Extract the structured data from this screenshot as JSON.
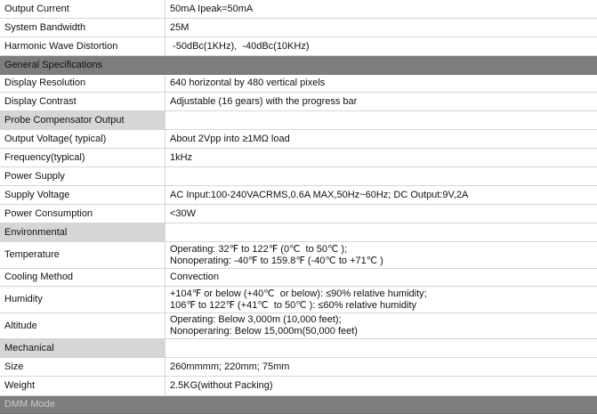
{
  "table": {
    "rows": [
      {
        "kind": "spec",
        "label": "Output Current",
        "value": [
          "50mA Ipeak=50mA"
        ]
      },
      {
        "kind": "spec",
        "label": "System Bandwidth",
        "value": [
          "25M"
        ]
      },
      {
        "kind": "spec",
        "label": "Harmonic Wave Distortion",
        "value": [
          " -50dBc(1KHz),  -40dBc(10KHz)"
        ]
      },
      {
        "kind": "section-dark",
        "label": "General Specifications"
      },
      {
        "kind": "spec",
        "label": "Display Resolution",
        "value": [
          "640 horizontal by 480 vertical pixels"
        ]
      },
      {
        "kind": "spec",
        "label": "Display Contrast",
        "value": [
          "Adjustable (16 gears) with the progress bar"
        ]
      },
      {
        "kind": "section-light",
        "label": "Probe Compensator Output",
        "value": []
      },
      {
        "kind": "spec",
        "label": "Output Voltage( typical)",
        "value": [
          "About 2Vpp into ≥1MΩ load"
        ]
      },
      {
        "kind": "spec",
        "label": "Frequency(typical)",
        "value": [
          "1kHz"
        ]
      },
      {
        "kind": "spec",
        "label": "Power Supply",
        "value": []
      },
      {
        "kind": "spec",
        "label": "Supply Voltage",
        "value": [
          "AC Input:100-240VACRMS,0.6A MAX,50Hz~60Hz; DC Output:9V,2A"
        ]
      },
      {
        "kind": "spec",
        "label": "Power Consumption",
        "value": [
          "<30W"
        ]
      },
      {
        "kind": "section-light",
        "label": "Environmental",
        "value": []
      },
      {
        "kind": "spec",
        "label": "Temperature",
        "value": [
          "Operating: 32℉ to 122℉ (0℃  to 50℃ );",
          "Nonoperating: -40℉ to 159.8℉ (-40℃ to +71℃ )"
        ]
      },
      {
        "kind": "spec",
        "label": "Cooling Method",
        "value": [
          "Convection"
        ]
      },
      {
        "kind": "spec",
        "label": "Humidity",
        "value": [
          "+104℉ or below (+40℃  or below): ≤90% relative humidity;",
          "106℉ to 122℉ (+41℃  to 50℃ ): ≤60% relative humidity"
        ]
      },
      {
        "kind": "spec",
        "label": "Altitude",
        "value": [
          "Operating: Below 3,000m (10,000 feet);",
          "Nonoperaring: Below 15,000m(50,000 feet)"
        ]
      },
      {
        "kind": "section-light",
        "label": "Mechanical",
        "value": []
      },
      {
        "kind": "spec",
        "label": "Size",
        "value": [
          "260mmmm; 220mm; 75mm"
        ]
      },
      {
        "kind": "spec",
        "label": "Weight",
        "value": [
          "2.5KG(without Packing)"
        ]
      },
      {
        "kind": "section-dark-faded",
        "label": "DMM Mode"
      }
    ]
  }
}
